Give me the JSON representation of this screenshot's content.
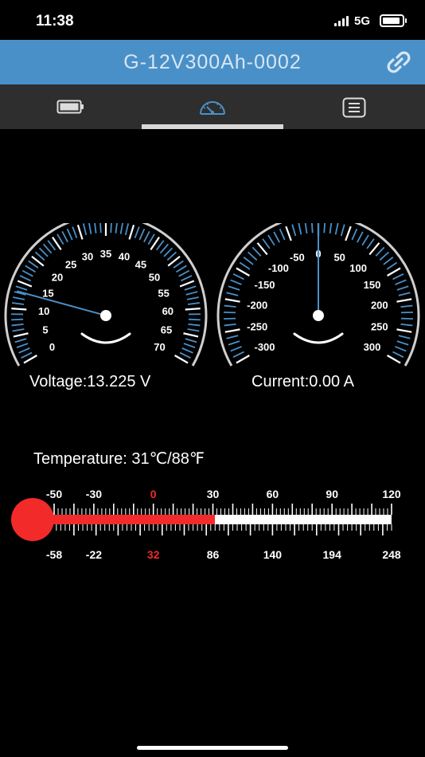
{
  "status_bar": {
    "time": "11:38",
    "network": "5G",
    "icons": [
      "signal-icon",
      "battery-icon"
    ]
  },
  "header": {
    "title": "G-12V300Ah-0002",
    "link_icon": "link-icon",
    "background_color": "#4a90c8"
  },
  "tabs": [
    {
      "name": "battery",
      "icon": "battery-icon",
      "selected": false
    },
    {
      "name": "gauge",
      "icon": "speedometer-icon",
      "selected": true
    },
    {
      "name": "list",
      "icon": "list-icon",
      "selected": false
    }
  ],
  "voltage_gauge": {
    "scale_labels": [
      "0",
      "5",
      "10",
      "15",
      "20",
      "25",
      "30",
      "35",
      "40",
      "45",
      "50",
      "55",
      "60",
      "65",
      "70"
    ],
    "min": 0,
    "max": 70,
    "value": 13.225,
    "label": "Voltage:13.225 V"
  },
  "current_gauge": {
    "scale_labels": [
      "-300",
      "-250",
      "-200",
      "-150",
      "-100",
      "-50",
      "0",
      "50",
      "100",
      "150",
      "200",
      "250",
      "300"
    ],
    "min": -300,
    "max": 300,
    "value": 0.0,
    "label": "Current:0.00 A"
  },
  "temperature": {
    "label": "Temperature:  31℃/88℉",
    "celsius_labels": [
      "-50",
      "-30",
      "0",
      "30",
      "60",
      "90",
      "120"
    ],
    "fahrenheit_labels": [
      "-58",
      "-22",
      "32",
      "86",
      "140",
      "194",
      "248"
    ],
    "celsius_value": 31,
    "celsius_min": -50,
    "celsius_max": 120,
    "highlight_color": "#f22a2a"
  }
}
